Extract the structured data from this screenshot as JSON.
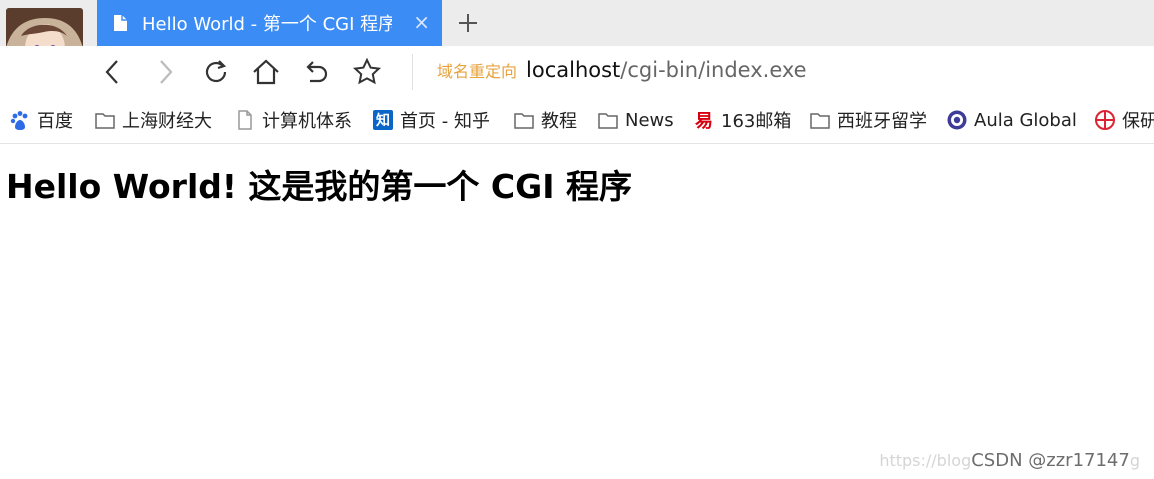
{
  "tab": {
    "title": "Hello World - 第一个 CGI 程序",
    "close": "×"
  },
  "newtab": {
    "label": "+"
  },
  "address": {
    "redirect_hint": "域名重定向",
    "host": "localhost",
    "path": "/cgi-bin/index.exe"
  },
  "bookmarks": [
    {
      "label": "百度",
      "icon": "baidu-paw-icon"
    },
    {
      "label": "上海财经大",
      "icon": "folder-icon"
    },
    {
      "label": "计算机体系",
      "icon": "page-icon"
    },
    {
      "label": "首页 - 知乎",
      "icon": "zhihu-icon"
    },
    {
      "label": "教程",
      "icon": "folder-icon"
    },
    {
      "label": "News",
      "icon": "folder-icon"
    },
    {
      "label": "163邮箱",
      "icon": "163-mail-icon"
    },
    {
      "label": "西班牙留学",
      "icon": "folder-icon"
    },
    {
      "label": "Aula Global",
      "icon": "aula-global-icon"
    },
    {
      "label": "保研",
      "icon": "grid-circle-icon"
    }
  ],
  "page": {
    "heading": "Hello World! 这是我的第一个 CGI 程序"
  },
  "watermark": {
    "faint": "https://blog",
    "main": "CSDN @zzr17147",
    "tail": "g"
  },
  "colors": {
    "tab_active": "#3b8cf5",
    "redirect_hint": "#e7a23e"
  }
}
